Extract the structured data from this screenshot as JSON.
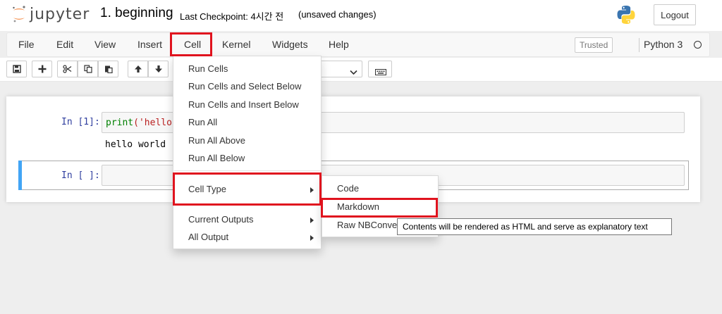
{
  "header": {
    "logo_text": "jupyter",
    "notebook_name": "1. beginning",
    "checkpoint": "Last Checkpoint: 4시간 전",
    "autosave_status": "(unsaved changes)",
    "logout_label": "Logout"
  },
  "menubar": {
    "items": [
      "File",
      "Edit",
      "View",
      "Insert",
      "Cell",
      "Kernel",
      "Widgets",
      "Help"
    ],
    "trusted_label": "Trusted",
    "kernel_name": "Python 3"
  },
  "notebook": {
    "cells": [
      {
        "prompt": "In [1]:",
        "code_fn": "print",
        "code_rest": "('hello",
        "output": "hello world"
      },
      {
        "prompt": "In [ ]:",
        "code_fn": "",
        "code_rest": "",
        "output": ""
      }
    ]
  },
  "cell_menu": {
    "items": [
      "Run Cells",
      "Run Cells and Select Below",
      "Run Cells and Insert Below",
      "Run All",
      "Run All Above",
      "Run All Below",
      "Cell Type",
      "Current Outputs",
      "All Output"
    ]
  },
  "celltype_submenu": {
    "items": [
      "Code",
      "Markdown",
      "Raw NBConve"
    ]
  },
  "tooltip": {
    "text": "Contents will be rendered as HTML and serve as explanatory text"
  },
  "colors": {
    "highlight": "#e0131e",
    "prompt_blue": "#303f9f",
    "selected_cell": "#42a5f5"
  }
}
